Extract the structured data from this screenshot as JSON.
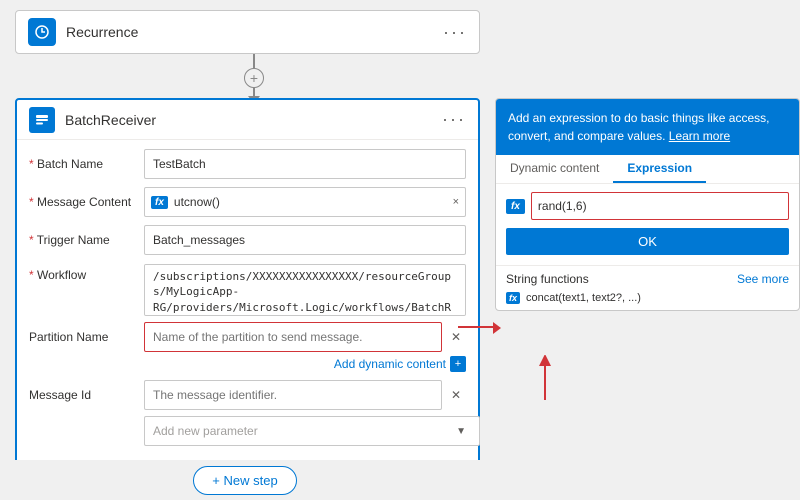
{
  "recurrence": {
    "title": "Recurrence",
    "icon": "timer",
    "more_label": "···"
  },
  "connector": {
    "plus_symbol": "+",
    "arrow": "▼"
  },
  "batch": {
    "title": "BatchReceiver",
    "more_label": "···",
    "fields": {
      "batch_name": {
        "label": "* Batch Name",
        "value": "TestBatch"
      },
      "message_content": {
        "label": "* Message Content",
        "fx_value": "utcnow()"
      },
      "trigger_name": {
        "label": "* Trigger Name",
        "value": "Batch_messages"
      },
      "workflow": {
        "label": "* Workflow",
        "value": "/subscriptions/XXXXXXXXXXXXXXXX/resourceGroups/MyLogicApp-RG/providers/Microsoft.Logic/workflows/BatchReceiver"
      },
      "partition_name": {
        "label": "Partition Name",
        "placeholder": "Name of the partition to send message."
      },
      "add_dynamic": "Add dynamic content",
      "message_id": {
        "label": "Message Id",
        "placeholder": "The message identifier."
      },
      "add_param": {
        "placeholder": "Add new parameter"
      }
    }
  },
  "new_step": {
    "label": "+ New step"
  },
  "expression_panel": {
    "header_text": "Add an expression to do basic things like access, convert, and compare values.",
    "learn_more": "Learn more",
    "tab_dynamic": "Dynamic content",
    "tab_expression": "Expression",
    "fx_badge": "fx",
    "input_value": "rand(1,6)",
    "ok_label": "OK",
    "string_section": {
      "header": "String functions",
      "more": "See more",
      "items": [
        {
          "fn": "concat(text1, text2?, ...)"
        }
      ]
    }
  }
}
